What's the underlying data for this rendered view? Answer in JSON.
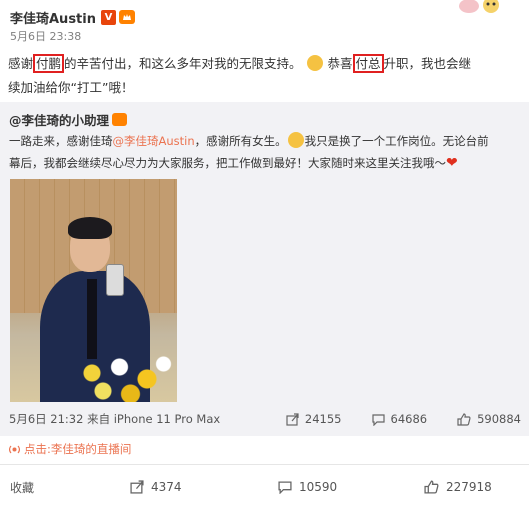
{
  "post": {
    "author": "李佳琦Austin",
    "verified_badge": "V",
    "time": "5月6日 23:38",
    "lines": [
      {
        "pre": "感谢",
        "boxed": "付鹏",
        "post": "的辛苦付出，和这么多年对我的无限支持。"
      },
      {
        "pre2": "恭喜",
        "boxed2": "付总",
        "post2": "升职，我也会继"
      },
      {
        "line2": "续加油给你“打工”哦！"
      }
    ],
    "text_line1_a": "感谢",
    "text_line1_boxed": "付鹏",
    "text_line1_b": "的辛苦付出，和这么多年对我的无限支持。",
    "text_line1_c": "恭喜",
    "text_line1_boxed2": "付总",
    "text_line1_d": "升职，我也会继",
    "text_line2": "续加油给你“打工”哦！"
  },
  "repost": {
    "author": "@李佳琦的小助理",
    "text_line1_a": "一路走来，感谢佳琦",
    "mention": "@李佳琦Austin",
    "text_line1_b": "，感谢所有女生。",
    "text_line1_c": "我只是换了一个工作岗位。无论台前",
    "text_line2": "幕后，我都会继续尽心尽力为大家服务，把工作做到最好！大家随时来这里关注我哦～",
    "meta": "5月6日 21:32 来自 iPhone 11 Pro Max",
    "reposts": "24155",
    "comments": "64686",
    "likes": "590884"
  },
  "live_link": "点击:李佳琦的直播间",
  "bottom_bar": {
    "favorite_label": "收藏",
    "reposts": "4374",
    "comments": "10590",
    "likes": "227918"
  },
  "colors": {
    "mention": "#eb7350",
    "highlight_box": "#e02020",
    "repost_bg": "#f2f2f5",
    "verified": "#e8450c",
    "vip": "#ff8200"
  }
}
